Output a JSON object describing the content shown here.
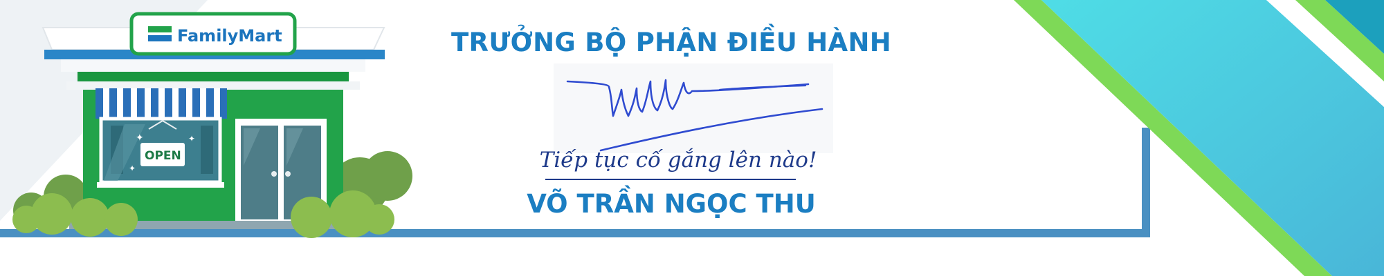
{
  "store": {
    "brand_name": "FamilyMart",
    "sign_text": "OPEN"
  },
  "card": {
    "title": "TRƯỞNG BỘ PHẬN ĐIỀU HÀNH",
    "tagline": "Tiếp tục cố gắng lên nào!",
    "name": "VÕ TRẦN NGỌC THU"
  },
  "colors": {
    "title_blue": "#1b7ec2",
    "frame_blue": "#4a90c2",
    "accent_green": "#7ed957",
    "accent_teal": "#4ecfe0",
    "store_green": "#22a34a"
  }
}
